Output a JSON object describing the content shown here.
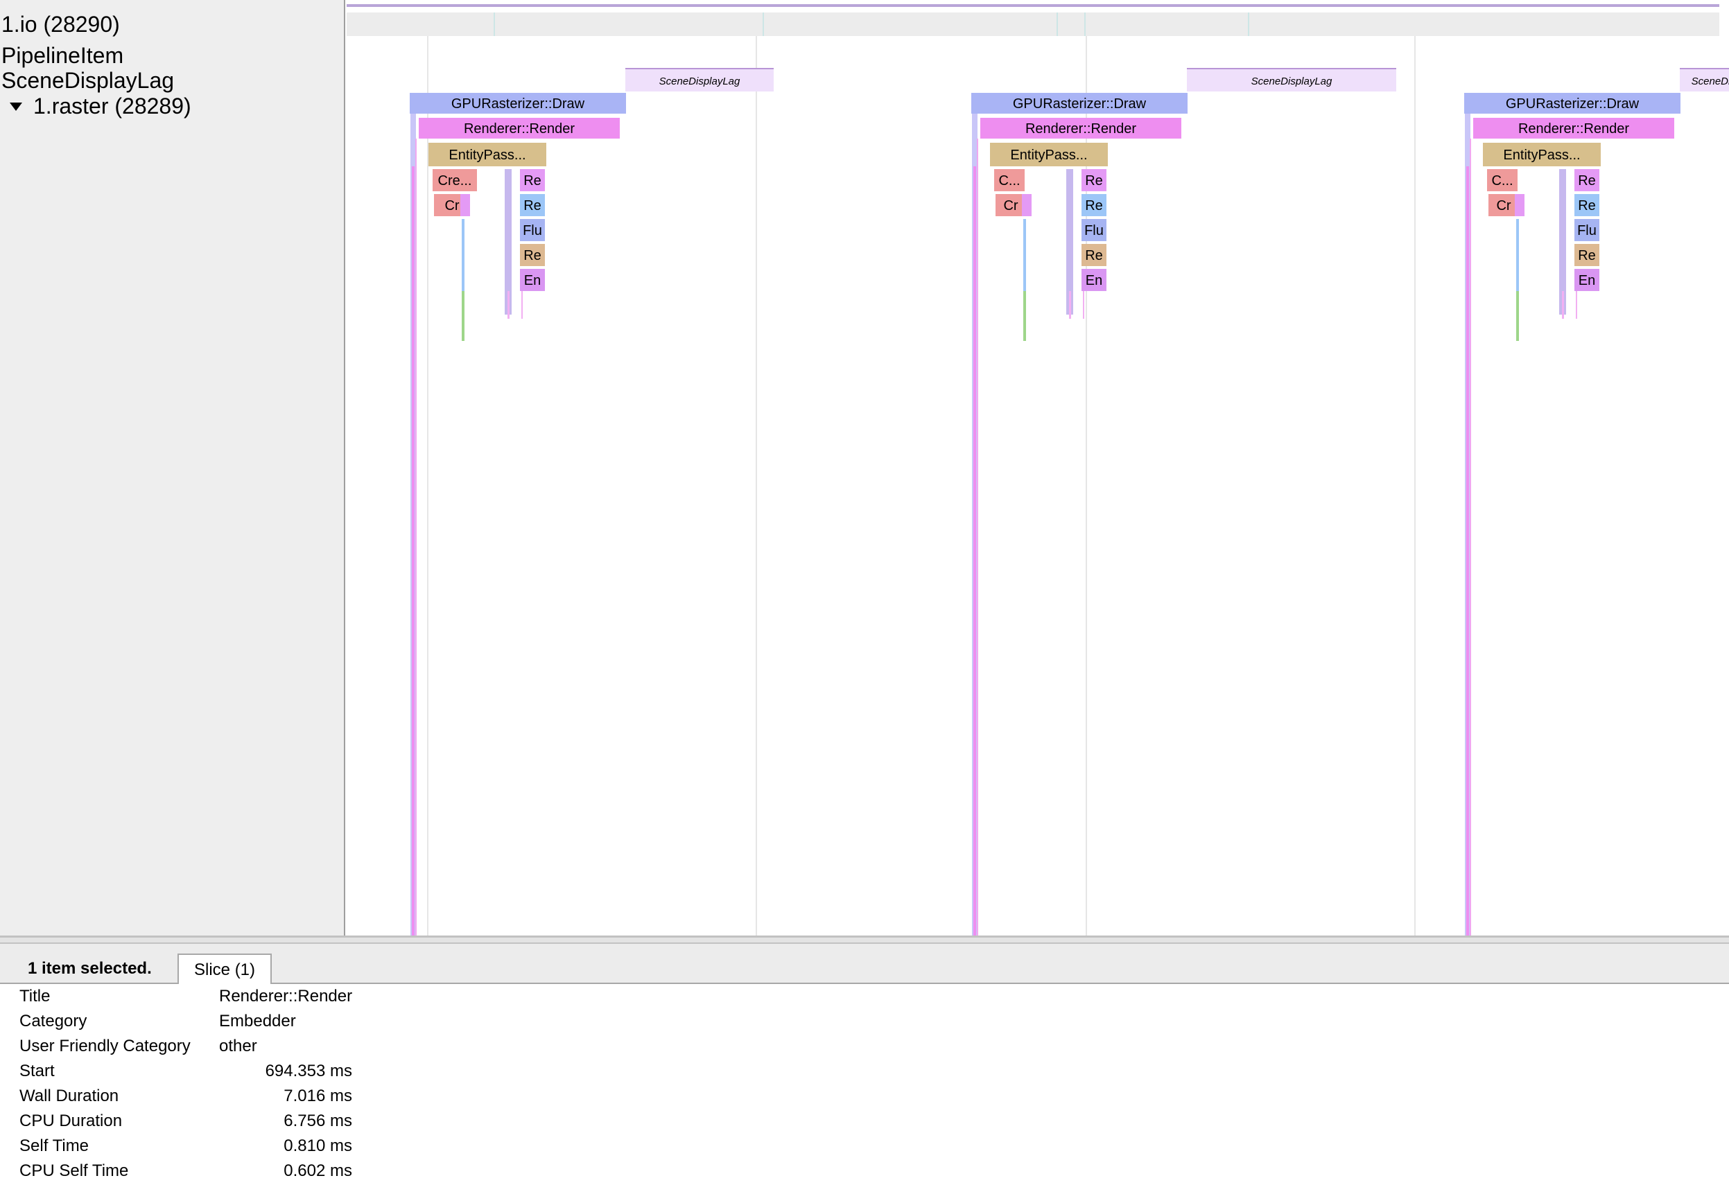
{
  "tracks": {
    "io_label": "1.io (28290)",
    "pipeline_label": "PipelineItem",
    "scene_label": "SceneDisplayLag",
    "raster_label": "1.raster (28289)"
  },
  "frames": [
    {
      "scene_display_lag": "SceneDisplayLag",
      "gpu_draw": "GPURasterizer::Draw",
      "renderer": "Renderer::Render",
      "entity_pass": "EntityPass...",
      "create_1": "Cre...",
      "create_2": "Cr",
      "right_col": [
        "Re",
        "Re",
        "Flu",
        "Re",
        "En"
      ]
    },
    {
      "scene_display_lag": "SceneDisplayLag",
      "gpu_draw": "GPURasterizer::Draw",
      "renderer": "Renderer::Render",
      "entity_pass": "EntityPass...",
      "create_1": "C...",
      "create_2": "Cr",
      "right_col": [
        "Re",
        "Re",
        "Flu",
        "Re",
        "En"
      ]
    },
    {
      "scene_display_lag": "SceneDisplayLag",
      "gpu_draw": "GPURasterizer::Draw",
      "renderer": "Renderer::Render",
      "entity_pass": "EntityPass...",
      "create_1": "C...",
      "create_2": "Cr",
      "right_col": [
        "Re",
        "Re",
        "Flu",
        "Re",
        "En"
      ]
    }
  ],
  "colors": {
    "gpu_draw": "#a9b4f5",
    "renderer": "#ee8ef0",
    "entity_pass": "#d7bf8c",
    "create": "#ef9a9a",
    "scene_lag": "#efe0fb",
    "re_pink": "#e49af5",
    "re_blue": "#9cc6f7",
    "flu_blue": "#a6b4f2",
    "re_tan": "#ddb992",
    "en_purple": "#d996f2"
  },
  "bottom_panel": {
    "selected_count": "1 item selected.",
    "tab_label": "Slice (1)",
    "details": [
      {
        "key": "Title",
        "value": "Renderer::Render"
      },
      {
        "key": "Category",
        "value": "Embedder"
      },
      {
        "key": "User Friendly Category",
        "value": "other"
      },
      {
        "key": "Start",
        "value": "694.353 ms"
      },
      {
        "key": "Wall Duration",
        "value": "7.016 ms"
      },
      {
        "key": "CPU Duration",
        "value": "6.756 ms"
      },
      {
        "key": "Self Time",
        "value": "0.810 ms"
      },
      {
        "key": "CPU Self Time",
        "value": "0.602 ms"
      }
    ]
  },
  "controls": {
    "pan_icon": "vertical-move-icon",
    "fit_icon": "fit-width-icon"
  }
}
